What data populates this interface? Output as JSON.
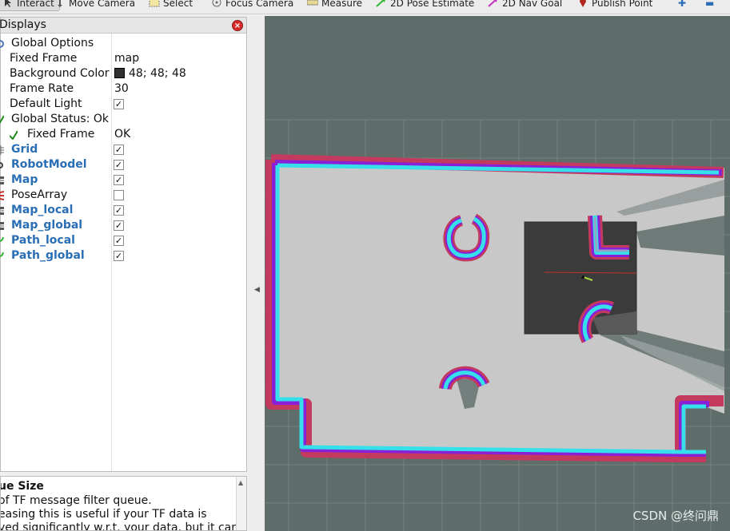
{
  "toolbar": {
    "tools": [
      {
        "name": "interact",
        "label": "Interact",
        "icon": "cursor-icon",
        "active": true
      },
      {
        "name": "move-camera",
        "label": "Move Camera",
        "icon": "move-camera-icon"
      },
      {
        "name": "select",
        "label": "Select",
        "icon": "select-icon"
      },
      {
        "name": "focus-camera",
        "label": "Focus Camera",
        "icon": "focus-camera-icon"
      },
      {
        "name": "measure",
        "label": "Measure",
        "icon": "measure-icon"
      },
      {
        "name": "2d-pose-estimate",
        "label": "2D Pose Estimate",
        "icon": "green-arrow-icon"
      },
      {
        "name": "2d-nav-goal",
        "label": "2D Nav Goal",
        "icon": "magenta-arrow-icon"
      },
      {
        "name": "publish-point",
        "label": "Publish Point",
        "icon": "pin-icon"
      }
    ]
  },
  "displays": {
    "title": "Displays",
    "global_options": {
      "label": "Global Options",
      "fixed_frame": {
        "label": "Fixed Frame",
        "value": "map"
      },
      "background_color": {
        "label": "Background Color",
        "value": "48; 48; 48",
        "swatch": "#303030"
      },
      "frame_rate": {
        "label": "Frame Rate",
        "value": "30"
      },
      "default_light": {
        "label": "Default Light",
        "checked": true
      }
    },
    "global_status": {
      "label": "Global Status: Ok",
      "fixed_frame": {
        "label": "Fixed Frame",
        "value": "OK"
      }
    },
    "items": [
      {
        "label": "Grid",
        "checked": true,
        "icon": "grid-icon"
      },
      {
        "label": "RobotModel",
        "checked": true,
        "icon": "robot-model-icon"
      },
      {
        "label": "Map",
        "checked": true,
        "icon": "map-icon"
      },
      {
        "label": "PoseArray",
        "checked": false,
        "icon": "pose-array-icon"
      },
      {
        "label": "Map_local",
        "checked": true,
        "icon": "map-icon"
      },
      {
        "label": "Map_global",
        "checked": true,
        "icon": "map-icon"
      },
      {
        "label": "Path_local",
        "checked": true,
        "icon": "path-icon"
      },
      {
        "label": "Path_global",
        "checked": true,
        "icon": "path-icon"
      }
    ]
  },
  "description": {
    "title": "ue Size",
    "lines": [
      " of TF message filter queue.",
      "easing this is useful if your TF data is",
      "yed significantly w.r.t. your data, but it can"
    ]
  },
  "viewport": {
    "background": "#5e6d6a",
    "watermark": "CSDN @终问鼎"
  },
  "colors": {
    "link_blue": "#2a6eb5",
    "costmap_cyan": "#35e0ea",
    "costmap_magenta": "#8a1fd8",
    "costmap_red": "#c33a5e",
    "free_space": "#c8c8c8",
    "unknown": "#5e6d6a"
  }
}
